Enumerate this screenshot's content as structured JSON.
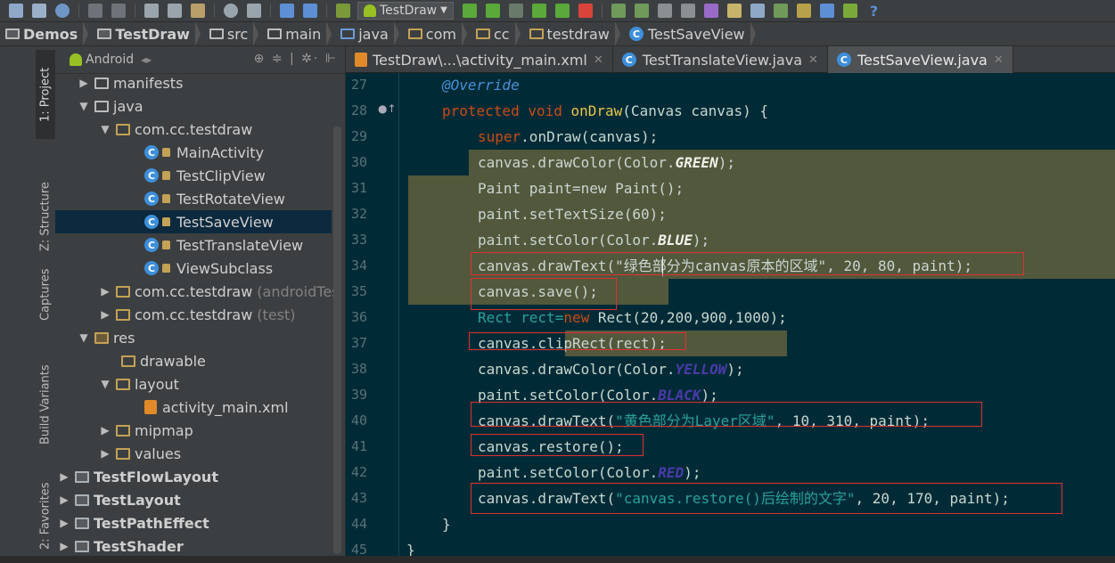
{
  "toolbar": {
    "run_config": "TestDraw",
    "help": "?"
  },
  "breadcrumb": [
    {
      "label": "Demos",
      "icon": "module-folder-icon"
    },
    {
      "label": "TestDraw",
      "icon": "module-folder-icon"
    },
    {
      "label": "src",
      "icon": "folder-icon"
    },
    {
      "label": "main",
      "icon": "folder-icon"
    },
    {
      "label": "java",
      "icon": "folder-icon"
    },
    {
      "label": "com",
      "icon": "package-icon"
    },
    {
      "label": "cc",
      "icon": "package-icon"
    },
    {
      "label": "testdraw",
      "icon": "package-icon"
    },
    {
      "label": "TestSaveView",
      "icon": "class-icon"
    }
  ],
  "side_tabs": {
    "project": "1: Project",
    "structure": "Z: Structure",
    "captures": "Captures",
    "build_variants": "Build Variants",
    "favorites": "2: Favorites"
  },
  "project": {
    "view_mode": "Android",
    "tree": [
      {
        "label": "manifests",
        "extra": ""
      },
      {
        "label": "java",
        "extra": ""
      },
      {
        "label": "com.cc.testdraw",
        "extra": ""
      },
      {
        "label": "MainActivity",
        "extra": ""
      },
      {
        "label": "TestClipView",
        "extra": ""
      },
      {
        "label": "TestRotateView",
        "extra": ""
      },
      {
        "label": "TestSaveView",
        "extra": ""
      },
      {
        "label": "TestTranslateView",
        "extra": ""
      },
      {
        "label": "ViewSubclass",
        "extra": ""
      },
      {
        "label": "com.cc.testdraw",
        "extra": "(androidTes"
      },
      {
        "label": "com.cc.testdraw",
        "extra": "(test)"
      },
      {
        "label": "res",
        "extra": ""
      },
      {
        "label": "drawable",
        "extra": ""
      },
      {
        "label": "layout",
        "extra": ""
      },
      {
        "label": "activity_main.xml",
        "extra": ""
      },
      {
        "label": "mipmap",
        "extra": ""
      },
      {
        "label": "values",
        "extra": ""
      },
      {
        "label": "TestFlowLayout",
        "extra": ""
      },
      {
        "label": "TestLayout",
        "extra": ""
      },
      {
        "label": "TestPathEffect",
        "extra": ""
      },
      {
        "label": "TestShader",
        "extra": ""
      }
    ]
  },
  "editor": {
    "tabs": [
      {
        "label": "TestDraw\\...\\activity_main.xml",
        "active": false
      },
      {
        "label": "TestTranslateView.java",
        "active": false
      },
      {
        "label": "TestSaveView.java",
        "active": true
      }
    ],
    "line_numbers": [
      "27",
      "28",
      "29",
      "30",
      "31",
      "32",
      "33",
      "34",
      "35",
      "36",
      "37",
      "38",
      "39",
      "40",
      "41",
      "42",
      "43",
      "44",
      "45"
    ],
    "code": {
      "l27": "@Override",
      "l28_kw": "protected void",
      "l28_fn": "onDraw",
      "l28_rest": "(Canvas canvas) {",
      "l29_kw": "super",
      "l29_rest": ".onDraw(canvas);",
      "l30_a": "canvas.drawColor(Color.",
      "l30_c": "GREEN",
      "l30_b": ");",
      "l31": "Paint paint=new Paint();",
      "l32": "paint.setTextSize(60);",
      "l33_a": "paint.setColor(Color.",
      "l33_c": "BLUE",
      "l33_b": ");",
      "l34_a": "canvas.drawText(",
      "l34_s": "\"绿色部分为canvas原本的区域\"",
      "l34_b": ", 20, 80, paint);",
      "l35": "canvas.save();",
      "l36_a": "Rect rect=",
      "l36_kw": "new",
      "l36_b": " Rect(20,200,900,1000);",
      "l37": "canvas.clipRect(rect);",
      "l38_a": "canvas.drawColor(Color.",
      "l38_c": "YELLOW",
      "l38_b": ");",
      "l39_a": "paint.setColor(Color.",
      "l39_c": "BLACK",
      "l39_b": ");",
      "l40_a": "canvas.drawText(",
      "l40_s": "\"黄色部分为Layer区域\"",
      "l40_b": ", 10, 310, paint);",
      "l41": "canvas.restore();",
      "l42_a": "paint.setColor(Color.",
      "l42_c": "RED",
      "l42_b": ");",
      "l43_a": "canvas.drawText(",
      "l43_s": "\"canvas.restore()后绘制的文字\"",
      "l43_b": ", 20, 170, paint);",
      "l44": "}",
      "l45": "}"
    }
  },
  "colors": {
    "editor_bg": "#002b36",
    "keyword": "#cb4b16",
    "function": "#e9c54a",
    "annotation": "#4b8fd8",
    "string": "#2aa198",
    "highlight": "#52583c",
    "red_box": "#e03030"
  }
}
